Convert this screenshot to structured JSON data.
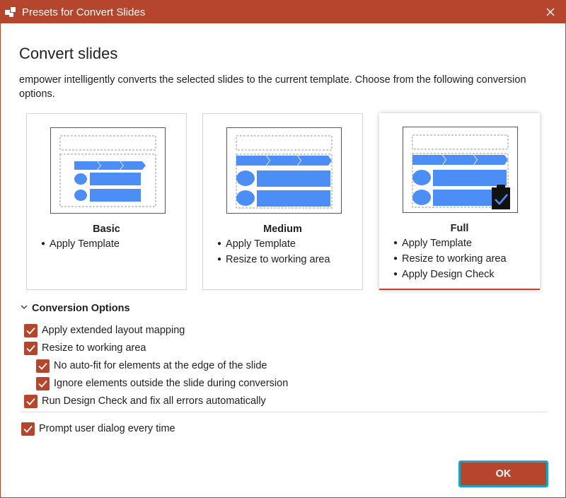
{
  "window": {
    "title": "Presets for Convert Slides",
    "close_icon": "close-icon",
    "logo_icon": "app-logo-icon"
  },
  "heading": "Convert slides",
  "description": "empower intelligently converts the selected slides to the current template. Choose from the following conversion options.",
  "presets": [
    {
      "title": "Basic",
      "items": [
        "Apply Template"
      ],
      "selected": false
    },
    {
      "title": "Medium",
      "items": [
        "Apply Template",
        "Resize to working area"
      ],
      "selected": false
    },
    {
      "title": "Full",
      "items": [
        "Apply Template",
        "Resize to working area",
        "Apply Design Check"
      ],
      "selected": true
    }
  ],
  "conversion_options": {
    "header": "Conversion Options",
    "expanded": true,
    "options": [
      {
        "label": "Apply extended layout mapping",
        "checked": true
      },
      {
        "label": "Resize to working area",
        "checked": true
      },
      {
        "label": "No auto-fit for elements at the edge of the slide",
        "checked": true
      },
      {
        "label": "Ignore elements outside the slide during conversion",
        "checked": true
      },
      {
        "label": "Run Design Check and fix all errors automatically",
        "checked": true
      }
    ]
  },
  "prompt_option": {
    "label": "Prompt user dialog every time",
    "checked": true
  },
  "ok_button": "OK",
  "colors": {
    "accent": "#b5452c",
    "focus_ring": "#1ba3c2",
    "thumb_blue": "#4d8df6"
  }
}
